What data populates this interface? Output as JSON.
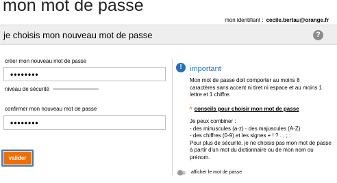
{
  "header": {
    "title": "mon mot de passe",
    "identity_label": "mon identifiant :",
    "identity_value": "cecile.bertau@orange.fr"
  },
  "section": {
    "title": "je choisis mon nouveau mot de passe",
    "help_icon": "question-circle-icon",
    "help_glyph": "?"
  },
  "form": {
    "new_password_label": "créer mon nouveau mot de passe",
    "new_password_value": "••••••••",
    "strength_label": "niveau de sécurité",
    "strength_level": 0,
    "confirm_password_label": "confirmer mon nouveau mot de passe",
    "confirm_password_value": "••••••••",
    "submit_label": "valider"
  },
  "info": {
    "icon": "info-circle-icon",
    "icon_glyph": "!",
    "title": "important",
    "rule_text": "Mon mot de passe doit comporter au moins 8 caractères sans accent ni tiret ni espace et au moins 1 lettre et 1 chiffre.",
    "tips_link": "conseils pour choisir mon mot de passe",
    "tips_caret": "^",
    "tips": {
      "intro": "Je peux combiner :",
      "line1": "- des minuscules (a-z) - des majuscules (A-Z)",
      "line2": "- des chiffres (0-9) et les signes + ! ? . , ; :",
      "advice": "Pour plus de sécurité, je ne choisis pas mon mot de passe à partir d'un mot du dictionnaire ou de mon nom ou prénom."
    },
    "show_password_label": "afficher le mot de passe",
    "show_password_on": false
  },
  "colors": {
    "accent": "#f16e00",
    "info_blue": "#1f6fc5",
    "focus_outline": "#3a78c3"
  }
}
